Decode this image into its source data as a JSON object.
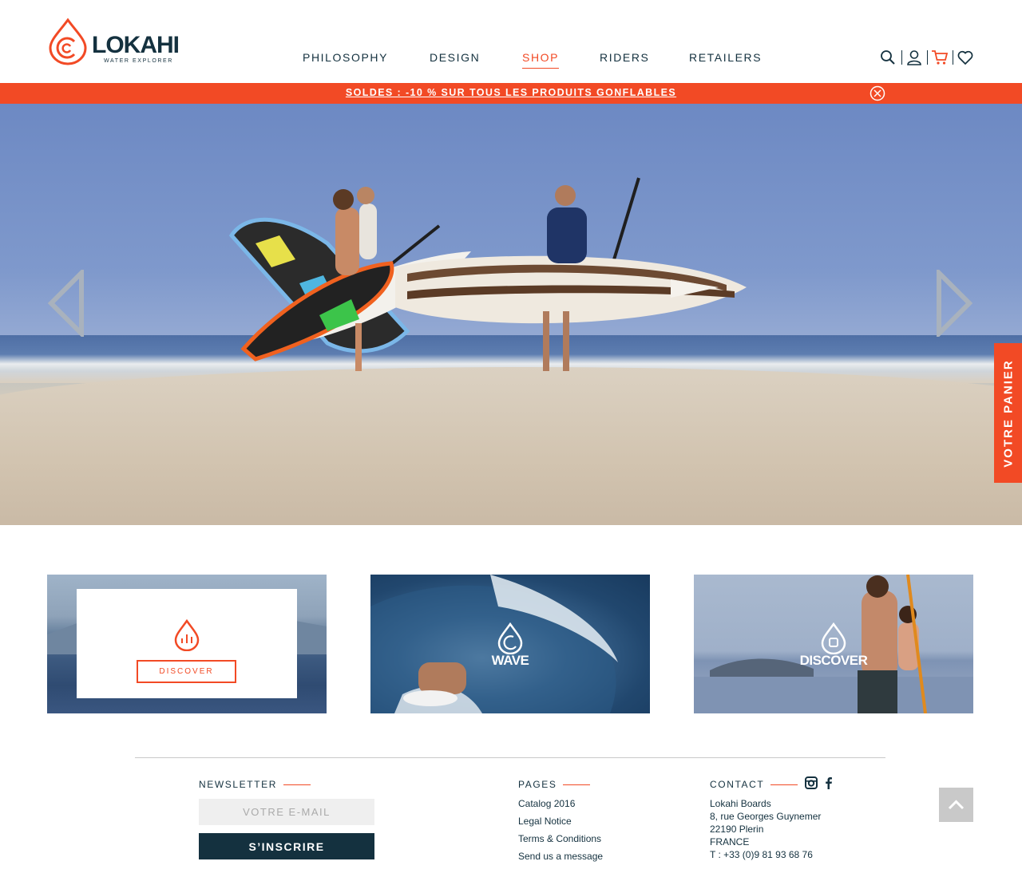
{
  "brand": {
    "name": "LOKAHI",
    "tagline": "WATER EXPLORER",
    "accent": "#f24a25",
    "navy": "#14313f"
  },
  "nav": [
    {
      "label": "PHILOSOPHY",
      "active": false
    },
    {
      "label": "DESIGN",
      "active": false
    },
    {
      "label": "SHOP",
      "active": true
    },
    {
      "label": "RIDERS",
      "active": false
    },
    {
      "label": "RETAILERS",
      "active": false
    }
  ],
  "tools": [
    "search-icon",
    "user-icon",
    "cart-icon",
    "heart-icon"
  ],
  "promo": {
    "text": "SOLDES : -10 % SUR TOUS LES PRODUITS GONFLABLES"
  },
  "hero": {
    "prev_icon": "chevron-left-icon",
    "next_icon": "chevron-right-icon"
  },
  "cart_tab": {
    "label": "VOTRE PANIER"
  },
  "tiles": [
    {
      "label": "DISCOVER",
      "icon": "drop-bars-icon",
      "hovered": true
    },
    {
      "label": "WAVE",
      "icon": "drop-wave-icon"
    },
    {
      "label": "DISCOVER",
      "icon": "drop-square-icon"
    }
  ],
  "footer": {
    "newsletter": {
      "heading": "NEWSLETTER",
      "placeholder": "VOTRE E-MAIL",
      "button": "S’INSCRIRE"
    },
    "pages": {
      "heading": "PAGES",
      "links": [
        "Catalog 2016",
        "Legal Notice",
        "Terms & Conditions",
        "Send us a message"
      ]
    },
    "contact": {
      "heading": "CONTACT",
      "lines": [
        "Lokahi Boards",
        "8, rue Georges Guynemer",
        "22190 Plerin",
        "FRANCE",
        "T : +33 (0)9 81 93 68 76"
      ],
      "social": [
        "instagram-icon",
        "facebook-icon"
      ]
    },
    "back_to_top_icon": "chevron-up-icon"
  }
}
